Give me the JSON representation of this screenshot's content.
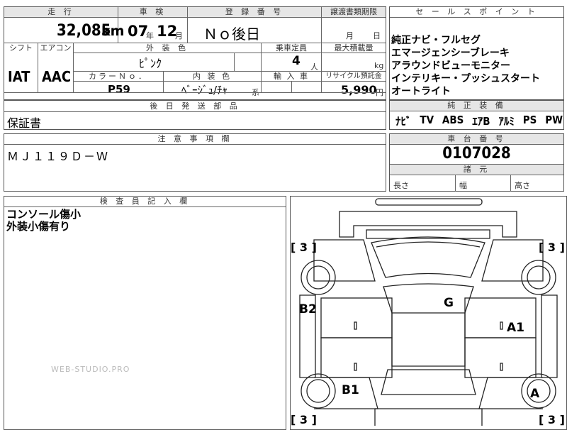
{
  "mileage": {
    "header": "走 行",
    "value": "32,085",
    "unit": "km"
  },
  "inspection": {
    "header": "車 検",
    "year": "07",
    "year_unit": "年",
    "month": "12",
    "month_unit": "月"
  },
  "registration": {
    "header": "登 録 番 号",
    "value": "Ｎｏ後日"
  },
  "transfer": {
    "header": "譲渡書類期限",
    "month_unit": "月",
    "day_unit": "日"
  },
  "shift": {
    "header": "シフト",
    "value": "IAT"
  },
  "aircon": {
    "header": "エアコン",
    "value": "AAC"
  },
  "exterior_color": {
    "header": "外 装 色",
    "value": "ﾋﾟﾝｸ"
  },
  "capacity": {
    "header": "乗車定員",
    "value": "4",
    "unit": "人"
  },
  "max_load": {
    "header": "最大積載量",
    "unit": "kg"
  },
  "color_no": {
    "header": "カラーＮｏ．",
    "value": "P59"
  },
  "interior_color": {
    "header": "内 装 色",
    "value": "ﾍﾞｰｼﾞｭ/ﾁｬ",
    "suffix": "系"
  },
  "import": {
    "header": "輸 入 車"
  },
  "recycle": {
    "header": "リサイクル預託金",
    "value": "5,990",
    "unit": "円"
  },
  "later_parts": {
    "header": "後 日 発 送 部 品",
    "value": "保証書"
  },
  "sales_points": {
    "header": "セ ー ル ス ポ イ ン ト",
    "items": [
      "純正ナビ・フルセグ",
      "エマージェンシーブレーキ",
      "アラウンドビューモニター",
      "インテリキー・プッシュスタート",
      "オートライト"
    ]
  },
  "genuine_equipment": {
    "header": "純 正 装 備",
    "items": [
      "ﾅﾋﾞ",
      "TV",
      "ABS",
      "ｴｱB",
      "ｱﾙﾐ",
      "PS",
      "PW"
    ]
  },
  "notes": {
    "header": "注 意 事 項 欄",
    "value": "ＭＪ１１９Ｄ－Ｗ"
  },
  "chassis": {
    "header": "車 台 番 号",
    "value": "0107028"
  },
  "dimensions": {
    "header": "諸 元",
    "length": "長さ",
    "width": "幅",
    "height": "高さ"
  },
  "inspector": {
    "header": "検 査 員 記 入 欄",
    "lines": [
      "コンソール傷小",
      "外装小傷有り"
    ]
  },
  "diagram": {
    "marks": {
      "g": "G",
      "a1": "A1",
      "a": "A",
      "b2": "B2",
      "b1": "B1"
    },
    "brackets": {
      "tl": "[ 3 ]",
      "tr": "[ 3 ]",
      "bl": "[ 3 ]",
      "br": "[ 3 ]"
    }
  },
  "watermark": "WEB-STUDIO.PRO"
}
